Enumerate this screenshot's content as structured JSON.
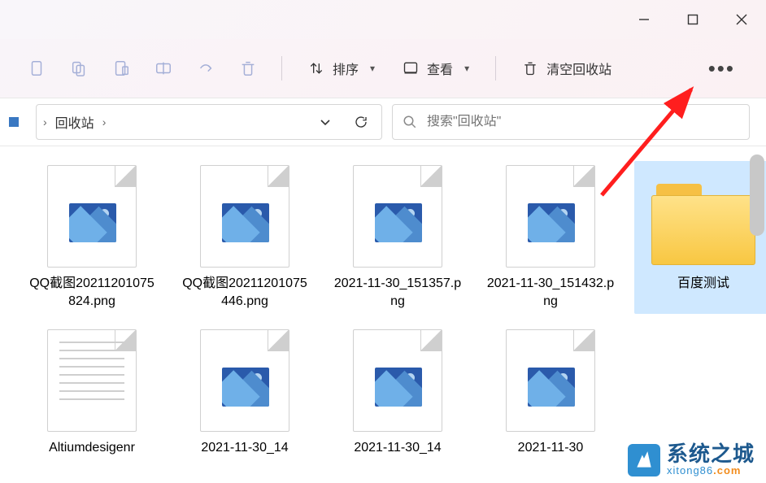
{
  "window": {
    "minimize": "minimize",
    "maximize": "maximize",
    "close": "close"
  },
  "toolbar": {
    "sort_label": "排序",
    "view_label": "查看",
    "empty_recycle_label": "清空回收站"
  },
  "address": {
    "location": "回收站",
    "caret": "›"
  },
  "search": {
    "placeholder": "搜索\"回收站\""
  },
  "items": [
    {
      "name": "QQ截图20211201075824.png",
      "type": "image"
    },
    {
      "name": "QQ截图20211201075446.png",
      "type": "image"
    },
    {
      "name": "2021-11-30_151357.png",
      "type": "image"
    },
    {
      "name": "2021-11-30_151432.png",
      "type": "image"
    },
    {
      "name": "百度测试",
      "type": "folder",
      "selected": true
    },
    {
      "name": "Altiumdesigenr",
      "type": "text"
    },
    {
      "name": "2021-11-30_14",
      "type": "image"
    },
    {
      "name": "2021-11-30_14",
      "type": "image"
    },
    {
      "name": "2021-11-30",
      "type": "image"
    }
  ],
  "watermark": {
    "title": "系统之城",
    "domain_prefix": "xitong86",
    "domain_suffix": ".com"
  }
}
